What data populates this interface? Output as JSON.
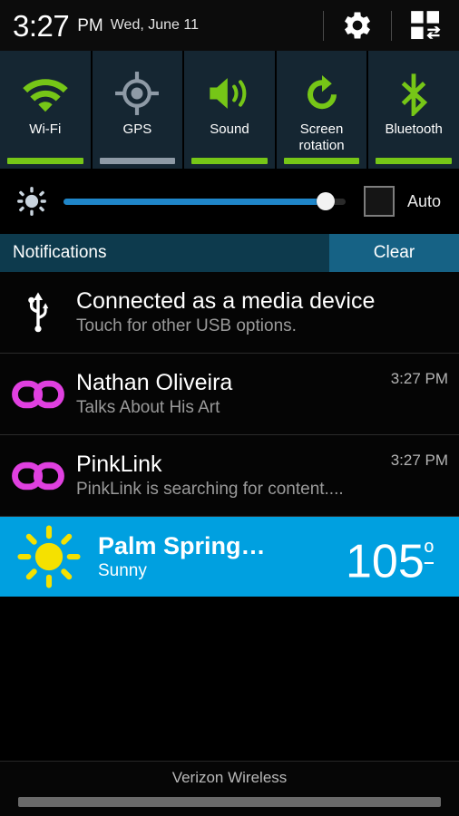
{
  "statusbar": {
    "time": "3:27",
    "ampm": "PM",
    "date": "Wed, June 11",
    "settings_icon": "gear-icon",
    "quick_panel_icon": "multi-window-icon"
  },
  "quick_toggles": [
    {
      "label": "Wi-Fi",
      "icon": "wifi-icon",
      "state": "on"
    },
    {
      "label": "GPS",
      "icon": "gps-icon",
      "state": "off"
    },
    {
      "label": "Sound",
      "icon": "sound-icon",
      "state": "on"
    },
    {
      "label": "Screen\nrotation",
      "label_line1": "Screen",
      "label_line2": "rotation",
      "icon": "screen-rotation-icon",
      "state": "on"
    },
    {
      "label": "Bluetooth",
      "icon": "bluetooth-icon",
      "state": "on"
    }
  ],
  "brightness": {
    "icon": "brightness-icon",
    "value_percent": 93,
    "auto_label": "Auto",
    "auto_checked": false,
    "track_color": "#1f86c9"
  },
  "notifications_header": {
    "title": "Notifications",
    "clear_label": "Clear"
  },
  "notifications": [
    {
      "icon": "usb-icon",
      "title": "Connected as a media device",
      "subtitle": "Touch for other USB options.",
      "time": ""
    },
    {
      "icon": "link-icon",
      "title": "Nathan Oliveira",
      "subtitle": "Talks About His Art",
      "time": "3:27 PM"
    },
    {
      "icon": "link-icon",
      "title": "PinkLink",
      "subtitle": "PinkLink is searching for content....",
      "time": "3:27 PM"
    }
  ],
  "weather": {
    "icon": "sun-icon",
    "city": "Palm Spring…",
    "condition": "Sunny",
    "temperature": "105",
    "degree": "º",
    "background_color": "#00a0e0"
  },
  "footer": {
    "carrier": "Verizon Wireless"
  },
  "colors": {
    "toggle_on": "#76c617",
    "toggle_off": "#8e9aa6",
    "panel": "#152632",
    "header": "#0d3a4d",
    "clear": "#166285",
    "link_icon": "#e040e0",
    "sun": "#f5e100"
  }
}
